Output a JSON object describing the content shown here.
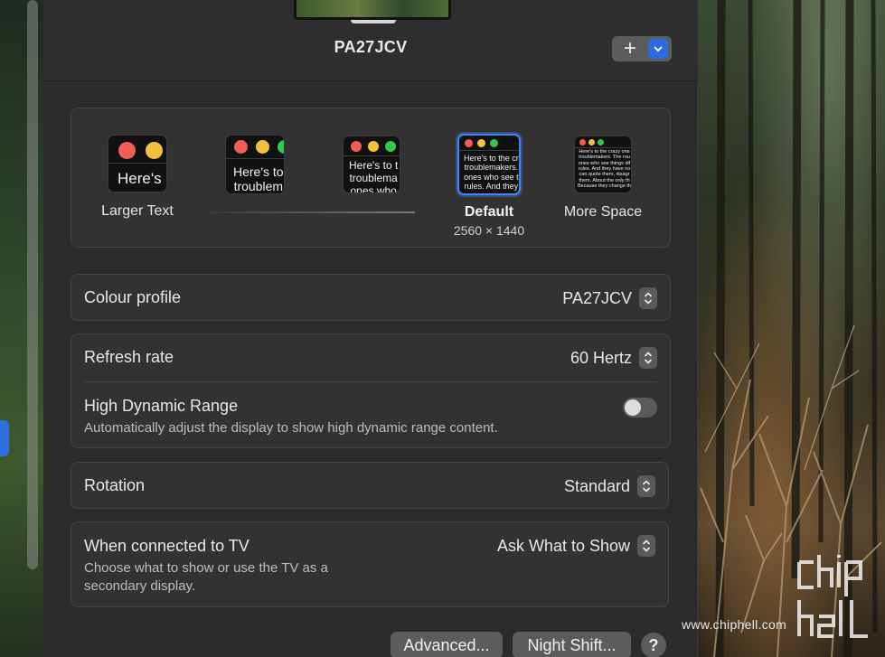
{
  "display": {
    "name": "PA27JCV"
  },
  "resolution": {
    "options": [
      {
        "label": "Larger Text",
        "sample": "Here's"
      },
      {
        "label": "",
        "sample": "Here's to\ntroublem"
      },
      {
        "label": "",
        "sample": "Here's to t\ntroublema\nones who"
      },
      {
        "label": "Default",
        "sub": "2560 × 1440",
        "sample": "Here's to the cr\ntroublemakers.\nones who see t\nrules. And they",
        "selected": true
      },
      {
        "label": "More Space",
        "sample": "Here's to the crazy one\ntroublemakers. The rou\nones who see things dif\nrules. And they have no\ncan quote them, disagr\nthem. About the only th\nBecause they change th"
      }
    ]
  },
  "settings": {
    "colour_profile": {
      "label": "Colour profile",
      "value": "PA27JCV"
    },
    "refresh_rate": {
      "label": "Refresh rate",
      "value": "60 Hertz"
    },
    "hdr": {
      "label": "High Dynamic Range",
      "desc": "Automatically adjust the display to show high dynamic range content.",
      "enabled": false
    },
    "rotation": {
      "label": "Rotation",
      "value": "Standard"
    },
    "tv": {
      "label": "When connected to TV",
      "desc": "Choose what to show or use the TV as a\nsecondary display.",
      "value": "Ask What to Show"
    }
  },
  "buttons": {
    "advanced": "Advanced...",
    "night_shift": "Night Shift...",
    "help": "?"
  },
  "watermark": {
    "url": "www.chiphell.com"
  },
  "colors": {
    "accent": "#3f86f5",
    "red": "#f25d55",
    "yellow": "#f4c23a",
    "green": "#35c748"
  }
}
